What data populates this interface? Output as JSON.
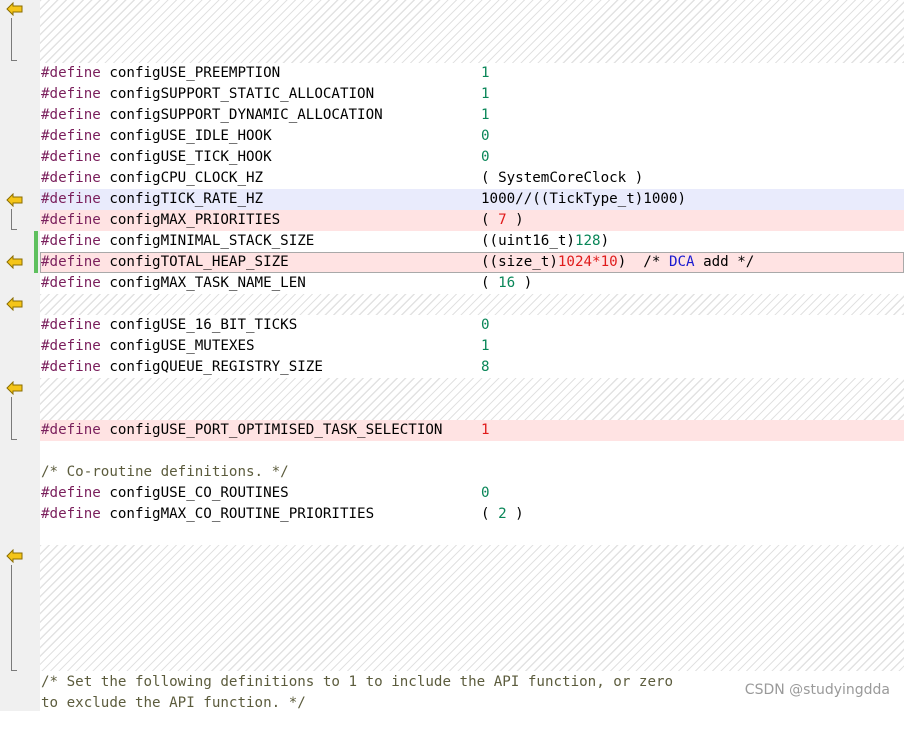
{
  "gutter_icons": [
    "diff-left-arrow-icon",
    "diff-bracket-icon"
  ],
  "colors": {
    "keyword": "#7a1f5c",
    "number": "#098658",
    "changed_number": "#e01b1b",
    "comment_token": "#1a1ad0",
    "comment": "#5c5c3d",
    "changed_line_bg": "#ffe3e3",
    "moved_line_bg": "#e9ebfc",
    "added_marker": "#5ec05e"
  },
  "lines": {
    "l1": {
      "kw": "#define",
      "name": " configUSE_PREEMPTION",
      "value": "1"
    },
    "l2": {
      "kw": "#define",
      "name": " configSUPPORT_STATIC_ALLOCATION",
      "value": "1"
    },
    "l3": {
      "kw": "#define",
      "name": " configSUPPORT_DYNAMIC_ALLOCATION",
      "value": "1"
    },
    "l4": {
      "kw": "#define",
      "name": " configUSE_IDLE_HOOK",
      "value": "0"
    },
    "l5": {
      "kw": "#define",
      "name": " configUSE_TICK_HOOK",
      "value": "0"
    },
    "l6": {
      "kw": "#define",
      "name": " configCPU_CLOCK_HZ",
      "value": "( SystemCoreClock )"
    },
    "l7": {
      "kw": "#define",
      "name": " configTICK_RATE_HZ",
      "value": "1000//((TickType_t)1000)"
    },
    "l8": {
      "kw": "#define",
      "name": " configMAX_PRIORITIES",
      "value_open": "( ",
      "value": "7",
      "value_close": " )"
    },
    "l9": {
      "kw": "#define",
      "name": " configMINIMAL_STACK_SIZE",
      "value_pre": "((uint16_t)",
      "value": "128",
      "value_post": ")"
    },
    "l10": {
      "kw": "#define",
      "name": " configTOTAL_HEAP_SIZE",
      "value_pre": "((size_t)",
      "value_a": "1024",
      "value_op": "*",
      "value_b": "10",
      "value_post": ")  /* ",
      "comment_word": "DCA",
      "comment_post": " add */"
    },
    "l11": {
      "kw": "#define",
      "name": " configMAX_TASK_NAME_LEN",
      "value_open": "( ",
      "value": "16",
      "value_close": " )"
    },
    "l12": {
      "kw": "#define",
      "name": " configUSE_16_BIT_TICKS",
      "value": "0"
    },
    "l13": {
      "kw": "#define",
      "name": " configUSE_MUTEXES",
      "value": "1"
    },
    "l14": {
      "kw": "#define",
      "name": " configQUEUE_REGISTRY_SIZE",
      "value": "8"
    },
    "l15": {
      "kw": "#define",
      "name": " configUSE_PORT_OPTIMISED_TASK_SELECTION",
      "value": "1"
    },
    "l16": {
      "comment": "/* Co-routine definitions. */"
    },
    "l17": {
      "kw": "#define",
      "name": " configUSE_CO_ROUTINES",
      "value": "0"
    },
    "l18": {
      "kw": "#define",
      "name": " configMAX_CO_ROUTINE_PRIORITIES",
      "value_open": "( ",
      "value": "2",
      "value_close": " )"
    },
    "l19": {
      "comment": "/* Set the following definitions to 1 to include the API function, or zero"
    },
    "l20": {
      "comment": "to exclude the API function. */"
    }
  },
  "watermark": "CSDN @studyingdda"
}
